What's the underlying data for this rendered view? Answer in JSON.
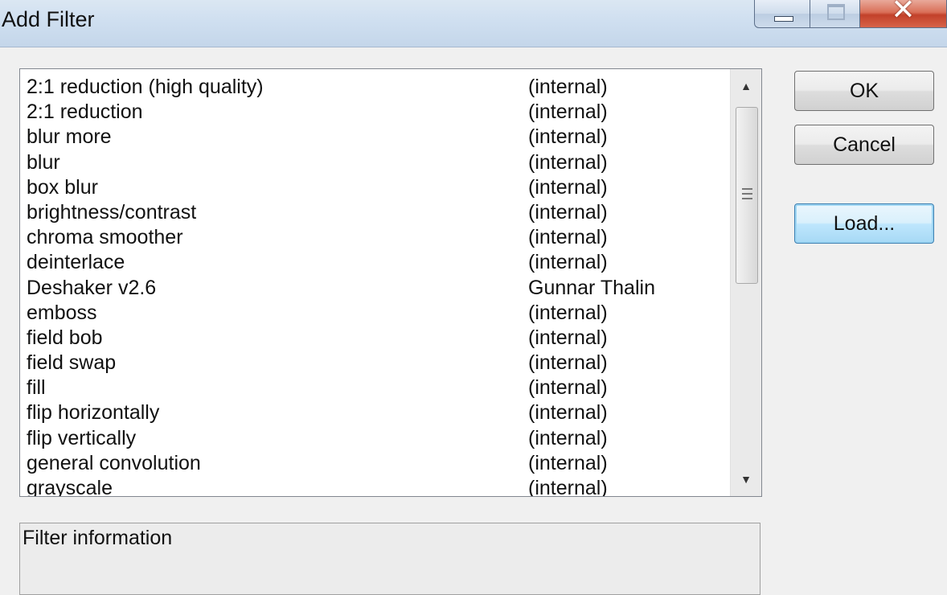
{
  "window": {
    "title": "Add Filter",
    "caption": {
      "minimize": "minimize-icon",
      "maximize": "maximize-icon",
      "close": "close-icon"
    }
  },
  "filters": [
    {
      "name": "2:1 reduction (high quality)",
      "author": "(internal)"
    },
    {
      "name": "2:1 reduction",
      "author": "(internal)"
    },
    {
      "name": "blur more",
      "author": "(internal)"
    },
    {
      "name": "blur",
      "author": "(internal)"
    },
    {
      "name": "box blur",
      "author": "(internal)"
    },
    {
      "name": "brightness/contrast",
      "author": "(internal)"
    },
    {
      "name": "chroma smoother",
      "author": "(internal)"
    },
    {
      "name": "deinterlace",
      "author": "(internal)"
    },
    {
      "name": "Deshaker v2.6",
      "author": "Gunnar Thalin"
    },
    {
      "name": "emboss",
      "author": "(internal)"
    },
    {
      "name": "field bob",
      "author": "(internal)"
    },
    {
      "name": "field swap",
      "author": "(internal)"
    },
    {
      "name": "fill",
      "author": "(internal)"
    },
    {
      "name": "flip horizontally",
      "author": "(internal)"
    },
    {
      "name": "flip vertically",
      "author": "(internal)"
    },
    {
      "name": "general convolution",
      "author": "(internal)"
    },
    {
      "name": "grayscale",
      "author": "(internal)"
    }
  ],
  "buttons": {
    "ok": "OK",
    "cancel": "Cancel",
    "load": "Load..."
  },
  "info": {
    "label": "Filter information"
  },
  "scrollbar": {
    "up_icon": "scroll-up-arrow-icon",
    "down_icon": "scroll-down-arrow-icon"
  }
}
